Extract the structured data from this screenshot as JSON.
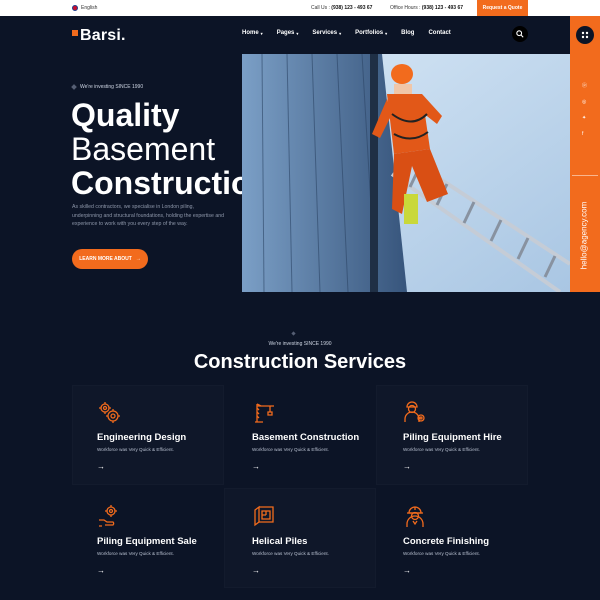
{
  "topbar": {
    "language": "English",
    "call_label": "Call Us :",
    "call_number": "(938) 123 - 493 67",
    "hours_label": "Office Hours :",
    "hours_number": "(938) 123 - 493 67",
    "quote_button": "Request a Quote"
  },
  "brand": {
    "name": "Barsi."
  },
  "nav": {
    "items": [
      {
        "label": "Home"
      },
      {
        "label": "Pages"
      },
      {
        "label": "Services"
      },
      {
        "label": "Portfolios"
      },
      {
        "label": "Blog"
      },
      {
        "label": "Contact"
      }
    ]
  },
  "hero": {
    "kicker": "We're investing SINCE 1990",
    "title_line1": "Quality",
    "title_line2": "Basement",
    "title_line3": "Construction",
    "description": "As skilled contractors, we specialise in London piling, underpinning and structural foundations, holding the expertise and experience to work with you every step of the way.",
    "cta": "LEARN MORE ABOUT"
  },
  "side": {
    "email": "hello@agency.com"
  },
  "services": {
    "kicker": "We're investing SINCE 1990",
    "title": "Construction Services",
    "items": [
      {
        "name": "Engineering Design",
        "sub": "Workforce was Very Quick & Efficient.",
        "icon": "gears-icon"
      },
      {
        "name": "Basement Construction",
        "sub": "Workforce was Very Quick & Efficient.",
        "icon": "crane-icon"
      },
      {
        "name": "Piling Equipment Hire",
        "sub": "Workforce was Very Quick & Efficient.",
        "icon": "worker-gear-icon"
      },
      {
        "name": "Piling Equipment Sale",
        "sub": "Workforce was Very Quick & Efficient.",
        "icon": "hand-gear-icon"
      },
      {
        "name": "Helical Piles",
        "sub": "Workforce was Very Quick & Efficient.",
        "icon": "blueprint-icon"
      },
      {
        "name": "Concrete Finishing",
        "sub": "Workforce was Very Quick & Efficient.",
        "icon": "engineer-icon"
      }
    ]
  },
  "colors": {
    "accent": "#f26b1d",
    "background": "#0c1426"
  }
}
